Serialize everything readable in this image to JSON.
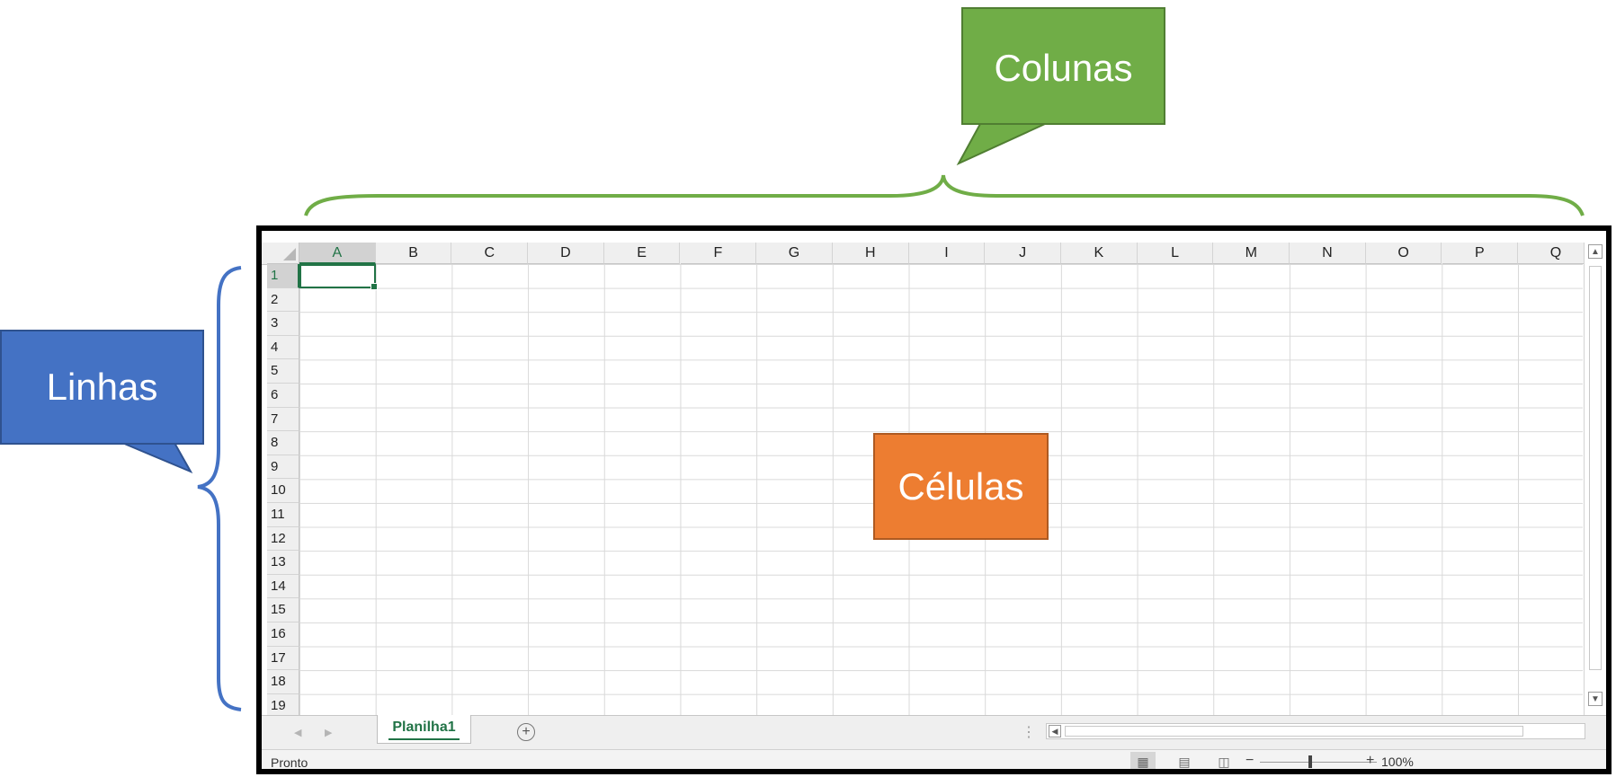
{
  "annotations": {
    "columns_label": "Colunas",
    "rows_label": "Linhas",
    "cells_label": "Células",
    "colors": {
      "columns": "#70ad47",
      "rows": "#4472c4",
      "cells": "#ed7d31"
    }
  },
  "spreadsheet": {
    "columns": [
      "A",
      "B",
      "C",
      "D",
      "E",
      "F",
      "G",
      "H",
      "I",
      "J",
      "K",
      "L",
      "M",
      "N",
      "O",
      "P",
      "Q"
    ],
    "rows": [
      "1",
      "2",
      "3",
      "4",
      "5",
      "6",
      "7",
      "8",
      "9",
      "10",
      "11",
      "12",
      "13",
      "14",
      "15",
      "16",
      "17",
      "18",
      "19"
    ],
    "selected_cell": "A1",
    "accent_color": "#217346",
    "vertical_scroll": {
      "up_icon": "arrow-up-icon",
      "down_icon": "arrow-down-icon"
    }
  },
  "sheet_tabs": {
    "tabs": [
      "Planilha1"
    ],
    "add_sheet_icon": "plus-circle-icon",
    "nav_icons": [
      "arrow-left-icon",
      "arrow-right-icon"
    ]
  },
  "status_bar": {
    "status": "Pronto",
    "views": [
      "normal-view-icon",
      "page-layout-view-icon",
      "page-break-preview-icon"
    ],
    "zoom_minus": "−",
    "zoom_plus": "+",
    "zoom_level": "100%"
  }
}
